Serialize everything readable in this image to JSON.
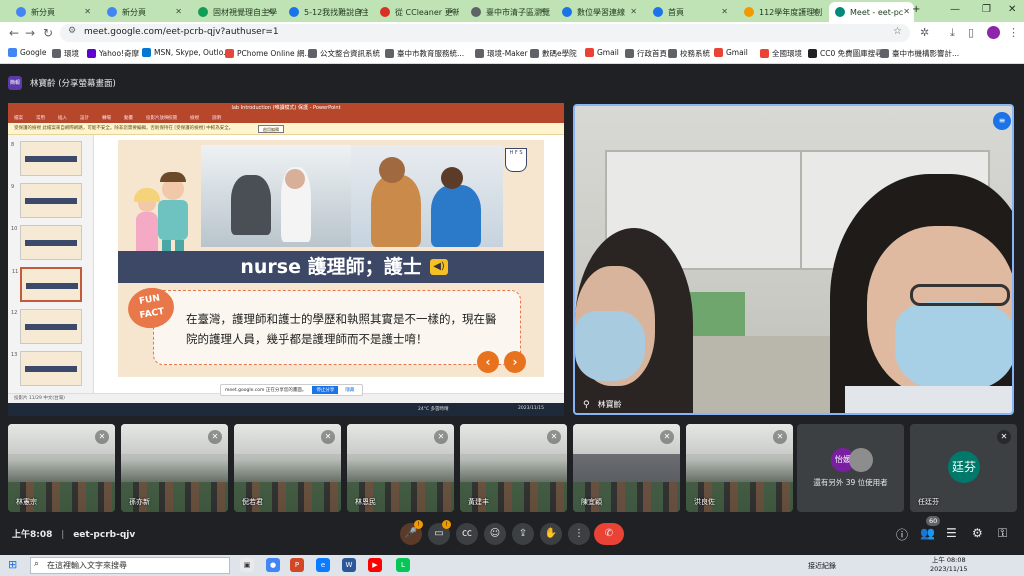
{
  "browser": {
    "tabs": [
      {
        "label": "新分頁",
        "color": "#4285f4"
      },
      {
        "label": "新分頁",
        "color": "#4285f4"
      },
      {
        "label": "固材視覺理自主學",
        "color": "#0f9d58"
      },
      {
        "label": "5-12我找難說自主",
        "color": "#1a73e8"
      },
      {
        "label": "從 CCleaner 更新",
        "color": "#d93025"
      },
      {
        "label": "臺中市清子區瀏覽",
        "color": "#5f6368"
      },
      {
        "label": "數位學習連線",
        "color": "#1a73e8"
      },
      {
        "label": "首頁",
        "color": "#1a73e8"
      },
      {
        "label": "112學年度護理創",
        "color": "#f29900"
      },
      {
        "label": "Meet - eet-pc",
        "color": "#00897b"
      }
    ],
    "url": "meet.google.com/eet-pcrb-qjv?authuser=1",
    "bookmarks": [
      {
        "label": "Google",
        "color": "#4285f4"
      },
      {
        "label": "環境",
        "color": "#5f6368"
      },
      {
        "label": "Yahoo!奇摩",
        "color": "#6001d2"
      },
      {
        "label": "MSN, Skype, Outlo...",
        "color": "#0078d4"
      },
      {
        "label": "PChome Online 網...",
        "color": "#e8453c"
      },
      {
        "label": "公文整合資訊系統",
        "color": "#5f6368"
      },
      {
        "label": "臺中市教育服務統...",
        "color": "#5f6368"
      },
      {
        "label": "環境-Maker",
        "color": "#5f6368"
      },
      {
        "label": "數碼e學院",
        "color": "#5f6368"
      },
      {
        "label": "Gmail",
        "color": "#ea4335"
      },
      {
        "label": "行政首頁",
        "color": "#5f6368"
      },
      {
        "label": "校務系統",
        "color": "#5f6368"
      },
      {
        "label": "Gmail",
        "color": "#ea4335"
      },
      {
        "label": "全國環境",
        "color": "#ea4335"
      },
      {
        "label": "CC0 免費圖庫搜尋...",
        "color": "#202124"
      },
      {
        "label": "臺中市機構影響計...",
        "color": "#5f6368"
      }
    ]
  },
  "meet": {
    "presenter_chip": "簡報",
    "presenter_label": "林寶齡 (分享螢幕畫面)",
    "main_participant": "林寶齡",
    "time": "上午8:08",
    "meeting_code": "eet-pcrb-qjv",
    "people_count": "60",
    "others_label": "還有另外 39 位使用者",
    "others_avatar": "怡媛",
    "participants": [
      {
        "name": "林憲宗"
      },
      {
        "name": "孫亦新"
      },
      {
        "name": "倪若君"
      },
      {
        "name": "林恩民"
      },
      {
        "name": "黃建丰"
      },
      {
        "name": "陳宜穎"
      },
      {
        "name": "洪良佐"
      },
      {
        "name": "任廷芬",
        "avatar": "廷芬"
      }
    ]
  },
  "shared_screen": {
    "window_title": "lab Introduction (唯讀模式) 保護 - PowerPoint",
    "ribbon": [
      "檔案",
      "常用",
      "插入",
      "設計",
      "轉場",
      "動畫",
      "投影片放映",
      "校閱",
      "檢視",
      "說明"
    ],
    "notice": "受保護的檢視    此檔案來自網際網路，可能不安全。除非您需要編輯，否則保持在 [受保護的檢視] 中較為安全。",
    "notice_button": "啟用編輯",
    "status": "投影片 11/29    中文(台灣)",
    "share_pill": "meet.google.com 正在分享您的畫面。",
    "share_stop": "停止分享",
    "share_hide": "隱藏",
    "taskbar_weather": "24°C 多雲時晴",
    "taskbar_time": "2023/11/15",
    "thumb_numbers": [
      "8",
      "9",
      "10",
      "11",
      "12",
      "13"
    ],
    "slide": {
      "badge": "H F S",
      "banner": "nurse 護理師；護士",
      "fun_fact": "FUN FACT",
      "fact": "在臺灣，護理師和護士的學歷和執照其實是不一樣的，現在醫院的護理人員，幾乎都是護理師而不是護士唷！"
    }
  },
  "os": {
    "search_placeholder": "在這裡輸入文字來搜尋",
    "weather": "接近紀錄",
    "clock_time": "上午 08:08",
    "clock_date": "2023/11/15"
  },
  "colors": {
    "accent": "#8ab4f8",
    "end_call": "#ea4335",
    "ppt_red": "#b7472a",
    "banner": "#3c4866"
  }
}
